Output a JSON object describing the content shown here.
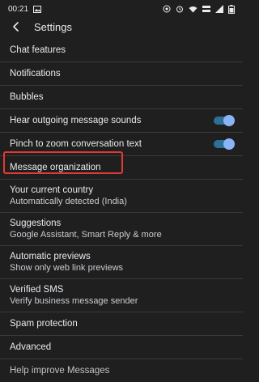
{
  "status_bar": {
    "time": "00:21",
    "left_icon": "image-icon",
    "right_icons": [
      "signal-quality-icon",
      "alarm-icon",
      "wifi-icon",
      "network-speed-icon",
      "cell-signal-icon",
      "battery-icon"
    ]
  },
  "header": {
    "title": "Settings",
    "back_icon": "back-arrow-icon"
  },
  "settings": {
    "chat_features": "Chat features",
    "notifications": "Notifications",
    "bubbles": "Bubbles",
    "hear_sounds": "Hear outgoing message sounds",
    "pinch_zoom": "Pinch to zoom conversation text",
    "message_organization": "Message organization",
    "country": {
      "label": "Your current country",
      "sub": "Automatically detected (India)"
    },
    "suggestions": {
      "label": "Suggestions",
      "sub": "Google Assistant, Smart Reply & more"
    },
    "automatic_previews": {
      "label": "Automatic previews",
      "sub": "Show only web link previews"
    },
    "verified_sms": {
      "label": "Verified SMS",
      "sub": "Verify business message sender"
    },
    "spam_protection": "Spam protection",
    "advanced": "Advanced",
    "help_improve": "Help improve Messages"
  },
  "toggles": {
    "hear_sounds": "on",
    "pinch_zoom": "on"
  },
  "colors": {
    "background": "#1f1f1f",
    "toggle_track": "#2f6f96",
    "toggle_knob": "#8ab4f8",
    "highlight_box": "#e53935"
  }
}
